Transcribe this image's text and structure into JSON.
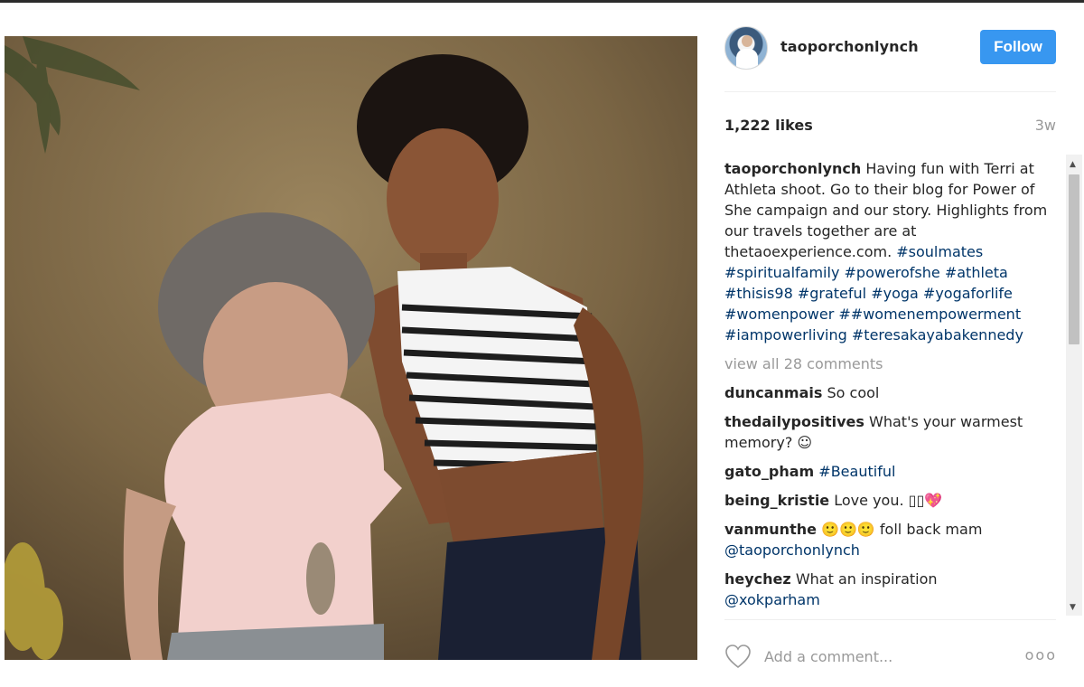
{
  "post": {
    "username": "taoporchonlynch",
    "follow_label": "Follow",
    "likes": "1,222 likes",
    "age": "3w",
    "caption": {
      "author": "taoporchonlynch",
      "text": "Having fun with Terri at Athleta shoot. Go to their blog for Power of She campaign and our story. Highlights from our travels together are at thetaoexperience.com.",
      "hashtags": "#soulmates #spiritualfamily #powerofshe #athleta #thisis98 #grateful #yoga #yogaforlife #womenpower ##womenempowerment #iampowerliving #teresakayabakennedy"
    },
    "view_all": "view all 28 comments",
    "comments": [
      {
        "author": "duncanmais",
        "text": "So cool",
        "tag": ""
      },
      {
        "author": "thedailypositives",
        "text": "What's your warmest memory? ☺",
        "tag": ""
      },
      {
        "author": "gato_pham",
        "text": "",
        "tag": "#Beautiful"
      },
      {
        "author": "being_kristie",
        "text": "Love you. ▯▯💖",
        "tag": ""
      },
      {
        "author": "vanmunthe",
        "text": "🙂🙂🙂 foll back mam",
        "tag": "@taoporchonlynch"
      },
      {
        "author": "heychez",
        "text": "What an inspiration",
        "tag": "@xokparham"
      }
    ],
    "add_comment_placeholder": "Add a comment...",
    "more_label": "ooo"
  },
  "icons": {
    "heart": "heart-icon",
    "more": "more-options-icon",
    "scroll_up": "scroll-up-arrow",
    "scroll_down": "scroll-down-arrow"
  },
  "colors": {
    "follow": "#3897f0",
    "link": "#003569",
    "muted": "#999999"
  }
}
